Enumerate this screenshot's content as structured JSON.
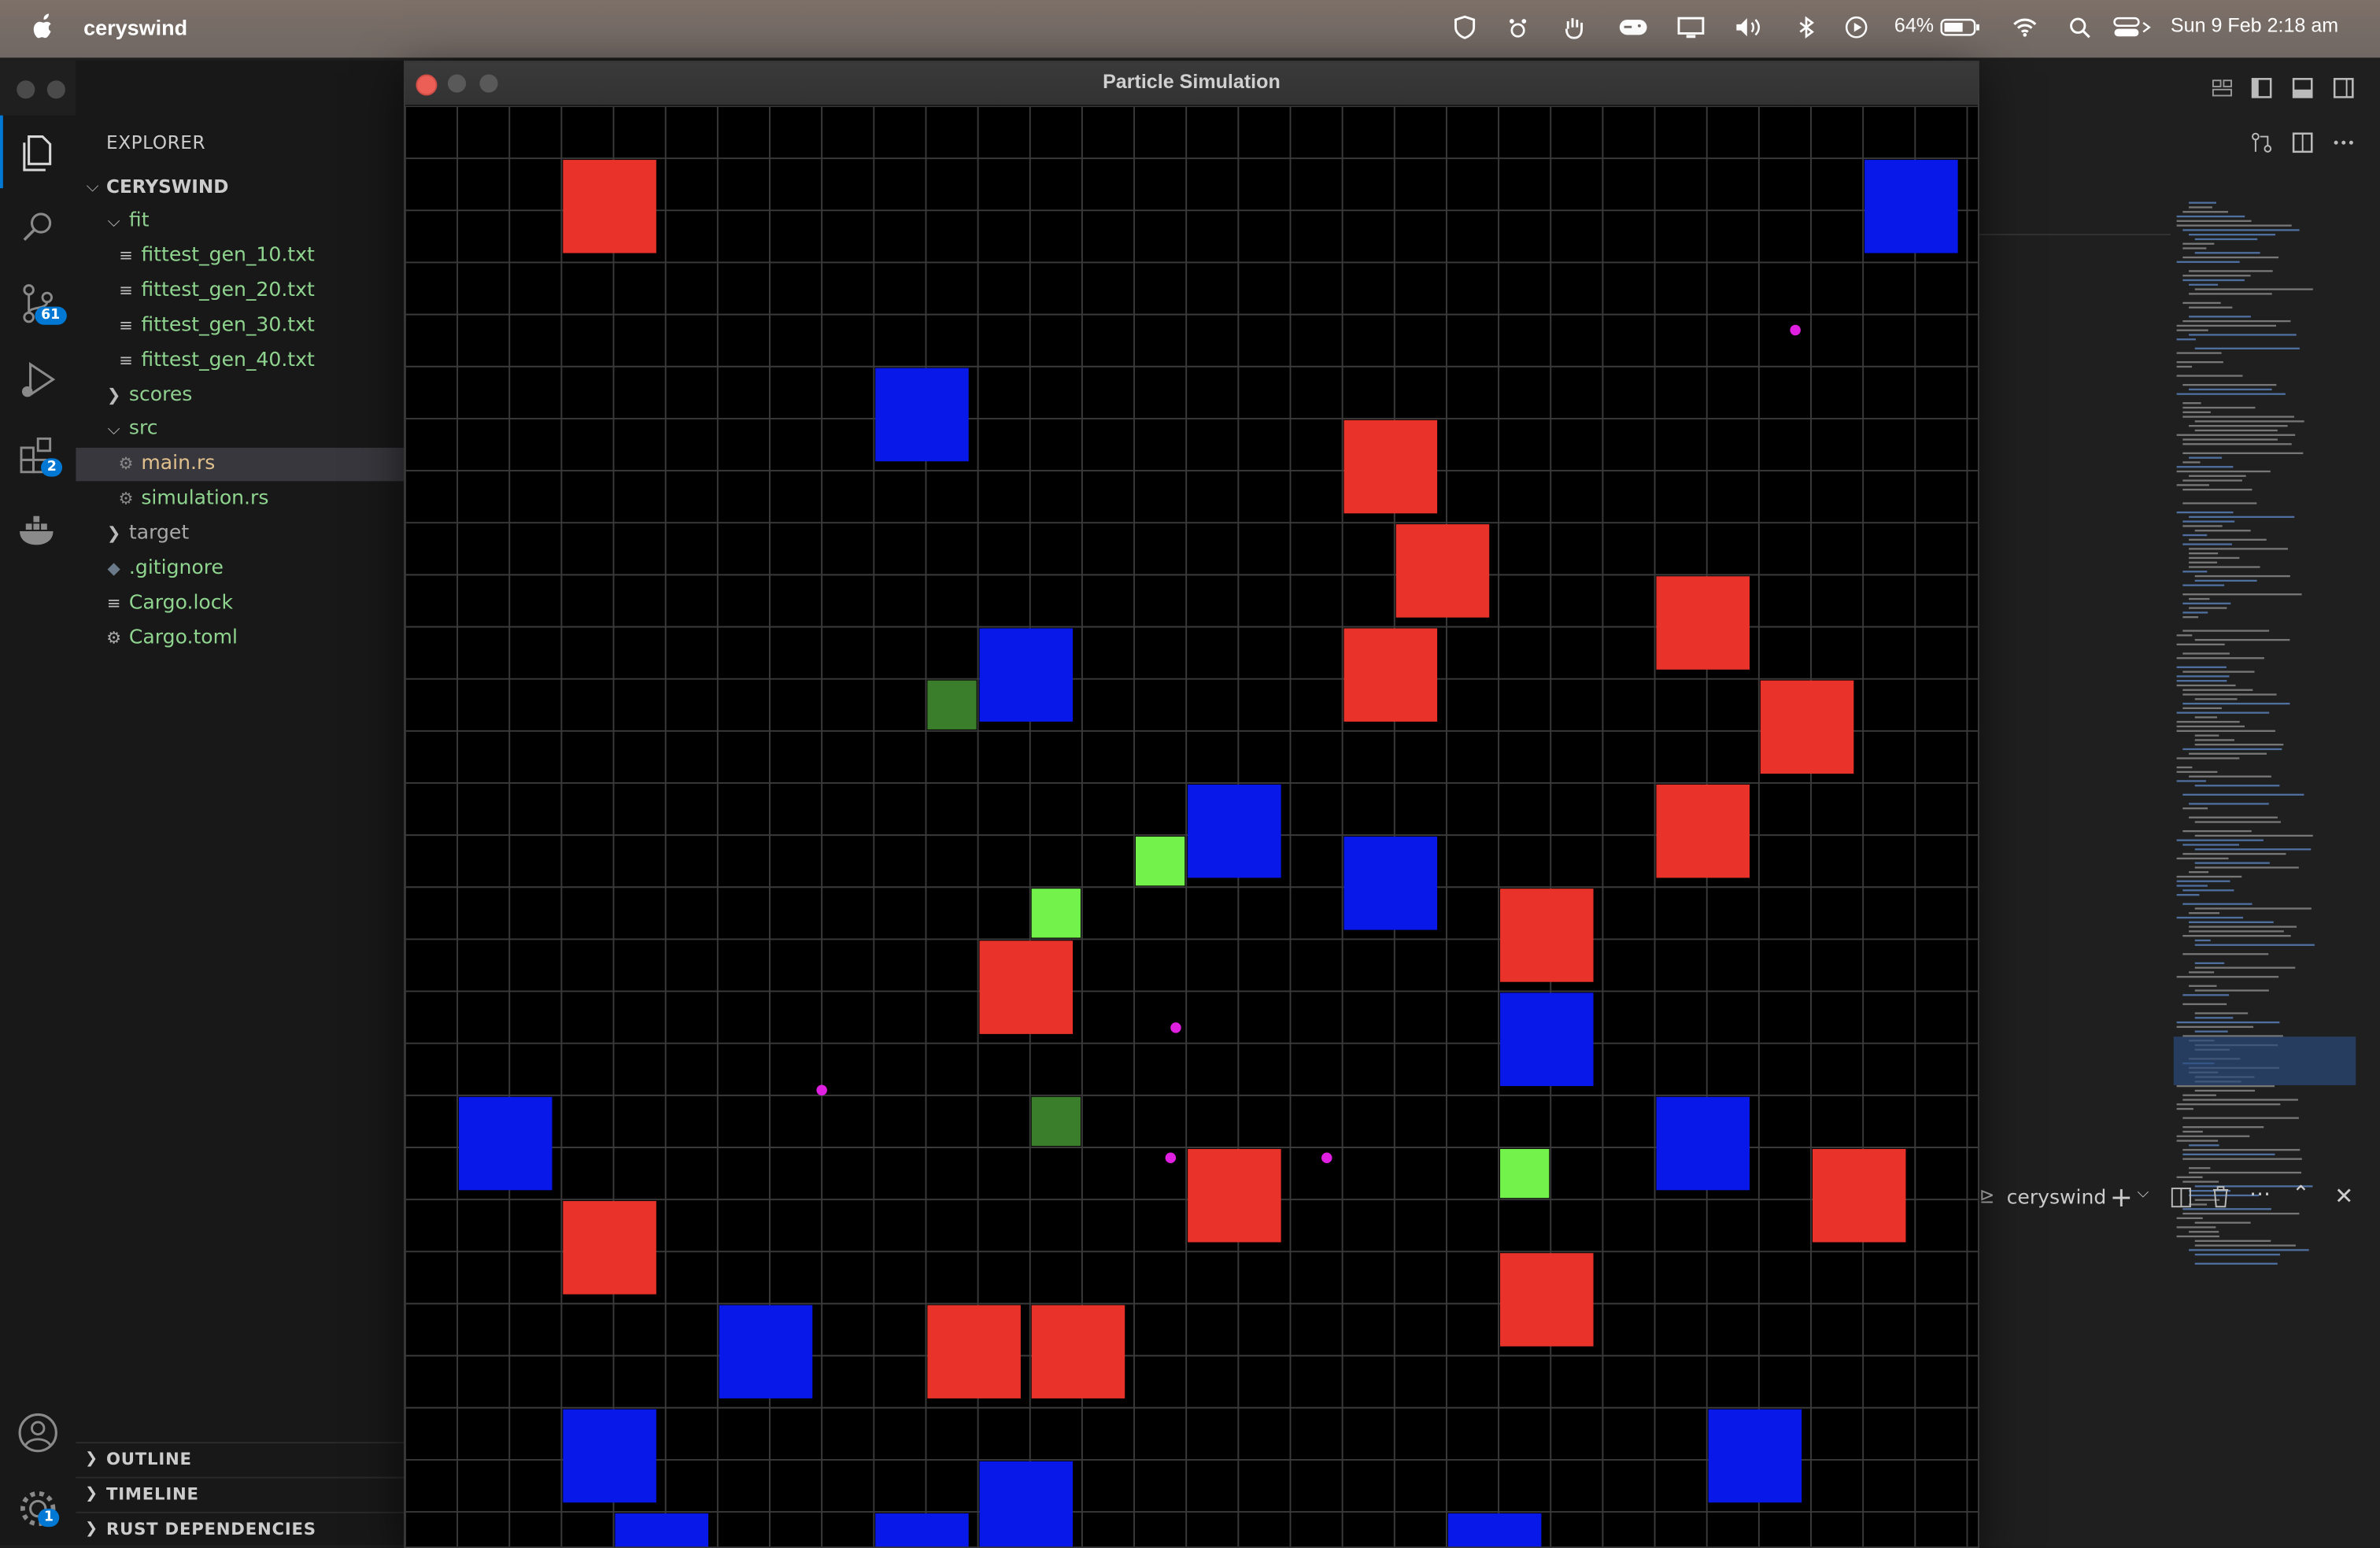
{
  "menubar": {
    "app_name": "ceryswind",
    "battery": "64%",
    "datetime": "Sun 9 Feb  2:18 am"
  },
  "activity_badges": {
    "source_control": "61",
    "extensions": "2",
    "accounts": "1"
  },
  "sidebar": {
    "title": "EXPLORER",
    "root": "CERYSWIND",
    "tree": [
      {
        "label": "fit",
        "kind": "folder-open",
        "depth": 1
      },
      {
        "label": "fittest_gen_10.txt",
        "kind": "file",
        "depth": 2
      },
      {
        "label": "fittest_gen_20.txt",
        "kind": "file",
        "depth": 2
      },
      {
        "label": "fittest_gen_30.txt",
        "kind": "file",
        "depth": 2
      },
      {
        "label": "fittest_gen_40.txt",
        "kind": "file",
        "depth": 2
      },
      {
        "label": "scores",
        "kind": "folder-closed",
        "depth": 1
      },
      {
        "label": "src",
        "kind": "folder-open",
        "depth": 1
      },
      {
        "label": "main.rs",
        "kind": "rust",
        "depth": 2,
        "selected": true
      },
      {
        "label": "simulation.rs",
        "kind": "rust",
        "depth": 2
      },
      {
        "label": "target",
        "kind": "folder-closed-grey",
        "depth": 1
      },
      {
        "label": ".gitignore",
        "kind": "git",
        "depth": 1
      },
      {
        "label": "Cargo.lock",
        "kind": "file",
        "depth": 1
      },
      {
        "label": "Cargo.toml",
        "kind": "gear",
        "depth": 1
      }
    ],
    "sections": [
      "OUTLINE",
      "TIMELINE",
      "RUST DEPENDENCIES"
    ]
  },
  "terminal": {
    "label": "ceryswind"
  },
  "sim_window": {
    "title": "Particle Simulation",
    "colors": {
      "red": "#e8322a",
      "blue": "#0818e8",
      "light_green": "#72f24a",
      "dark_green": "#3a7d2a",
      "particle": "#e020e0",
      "grid": "#3a3a3a"
    },
    "grid_cols": 30,
    "grid_rows": 28,
    "blocks": [
      {
        "t": "red",
        "c": 3,
        "r": 1
      },
      {
        "t": "blue",
        "c": 28,
        "r": 1
      },
      {
        "t": "blue",
        "c": 9,
        "r": 5
      },
      {
        "t": "red",
        "c": 18,
        "r": 6
      },
      {
        "t": "red",
        "c": 19,
        "r": 8
      },
      {
        "t": "red",
        "c": 24,
        "r": 9
      },
      {
        "t": "blue",
        "c": 11,
        "r": 10
      },
      {
        "t": "red",
        "c": 18,
        "r": 10
      },
      {
        "t": "red",
        "c": 26,
        "r": 11
      },
      {
        "t": "blue",
        "c": 15,
        "r": 13
      },
      {
        "t": "red",
        "c": 24,
        "r": 13
      },
      {
        "t": "blue",
        "c": 18,
        "r": 14
      },
      {
        "t": "red",
        "c": 21,
        "r": 15
      },
      {
        "t": "red",
        "c": 11,
        "r": 16
      },
      {
        "t": "blue",
        "c": 21,
        "r": 17
      },
      {
        "t": "blue",
        "c": 1,
        "r": 19
      },
      {
        "t": "blue",
        "c": 24,
        "r": 19
      },
      {
        "t": "red",
        "c": 15,
        "r": 20
      },
      {
        "t": "red",
        "c": 27,
        "r": 20
      },
      {
        "t": "red",
        "c": 3,
        "r": 21
      },
      {
        "t": "red",
        "c": 21,
        "r": 22
      },
      {
        "t": "blue",
        "c": 6,
        "r": 23
      },
      {
        "t": "red",
        "c": 10,
        "r": 23
      },
      {
        "t": "red",
        "c": 12,
        "r": 23
      },
      {
        "t": "blue",
        "c": 3,
        "r": 25
      },
      {
        "t": "blue",
        "c": 25,
        "r": 25
      },
      {
        "t": "blue",
        "c": 11,
        "r": 26
      },
      {
        "t": "blue",
        "c": 4,
        "r": 27
      },
      {
        "t": "blue",
        "c": 9,
        "r": 27
      },
      {
        "t": "blue",
        "c": 20,
        "r": 27
      }
    ],
    "food": [
      {
        "t": "dark_green",
        "c": 10,
        "r": 11
      },
      {
        "t": "light_green",
        "c": 14,
        "r": 14
      },
      {
        "t": "light_green",
        "c": 12,
        "r": 15
      },
      {
        "t": "dark_green",
        "c": 12,
        "r": 19
      },
      {
        "t": "light_green",
        "c": 21,
        "r": 20
      }
    ],
    "particles": [
      {
        "x": 26.7,
        "y": 4.3
      },
      {
        "x": 14.8,
        "y": 17.7
      },
      {
        "x": 8.0,
        "y": 18.9
      },
      {
        "x": 14.7,
        "y": 20.2
      },
      {
        "x": 17.7,
        "y": 20.2
      }
    ]
  }
}
